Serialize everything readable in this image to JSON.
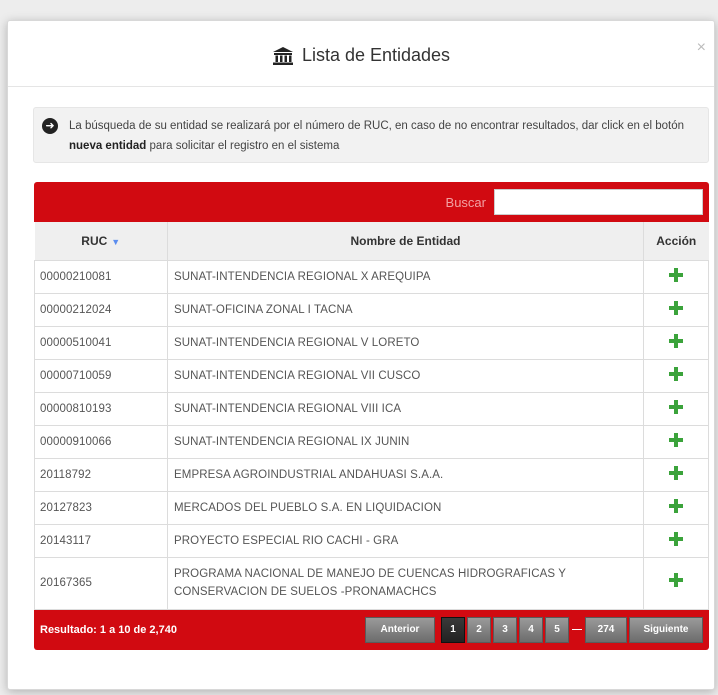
{
  "modal": {
    "title": "Lista de Entidades",
    "close_label": "×"
  },
  "info": {
    "text_before": "La búsqueda de su entidad se realizará por el número de RUC, en caso de no encontrar resultados, dar click en el botón ",
    "bold": "nueva entidad",
    "text_after": " para solicitar el registro en el sistema"
  },
  "search": {
    "label": "Buscar",
    "value": ""
  },
  "table": {
    "headers": {
      "ruc": "RUC",
      "nombre": "Nombre de Entidad",
      "accion": "Acción"
    },
    "rows": [
      {
        "ruc": "00000210081",
        "nombre": "SUNAT-INTENDENCIA REGIONAL X AREQUIPA"
      },
      {
        "ruc": "00000212024",
        "nombre": "SUNAT-OFICINA ZONAL I TACNA"
      },
      {
        "ruc": "00000510041",
        "nombre": "SUNAT-INTENDENCIA REGIONAL V LORETO"
      },
      {
        "ruc": "00000710059",
        "nombre": "SUNAT-INTENDENCIA REGIONAL VII CUSCO"
      },
      {
        "ruc": "00000810193",
        "nombre": "SUNAT-INTENDENCIA REGIONAL VIII ICA"
      },
      {
        "ruc": "00000910066",
        "nombre": "SUNAT-INTENDENCIA REGIONAL IX JUNIN"
      },
      {
        "ruc": "20118792",
        "nombre": "EMPRESA AGROINDUSTRIAL ANDAHUASI S.A.A."
      },
      {
        "ruc": "20127823",
        "nombre": "MERCADOS DEL PUEBLO S.A. EN LIQUIDACION"
      },
      {
        "ruc": "20143117",
        "nombre": "PROYECTO ESPECIAL RIO CACHI - GRA"
      },
      {
        "ruc": "20167365",
        "nombre": "PROGRAMA NACIONAL DE MANEJO DE CUENCAS HIDROGRAFICAS Y CONSERVACION DE SUELOS -PRONAMACHCS"
      }
    ]
  },
  "footer": {
    "result_text": "Resultado: 1 a 10 de 2,740",
    "prev_label": "Anterior",
    "pages": [
      "1",
      "2",
      "3",
      "4",
      "5"
    ],
    "active_page": "1",
    "last_page": "274",
    "next_label": "Siguiente"
  },
  "colors": {
    "accent_red": "#d10a11",
    "add_green": "#3ba33b",
    "sort_blue": "#5b8def"
  }
}
